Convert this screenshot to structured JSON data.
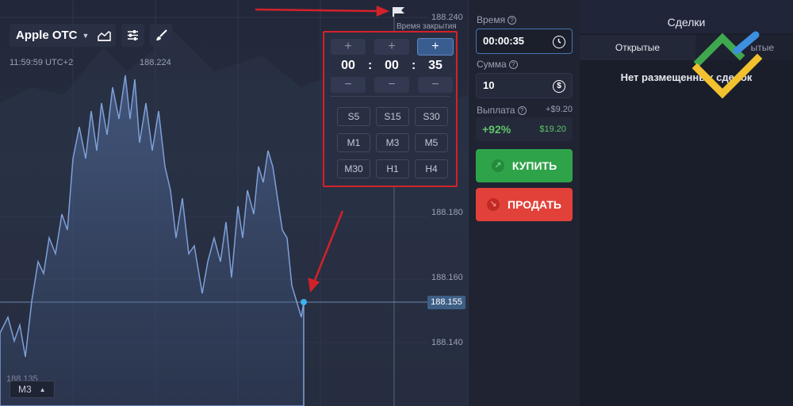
{
  "toolbar": {
    "asset_label": "Apple OTC",
    "timeframe_label": "M3"
  },
  "chart": {
    "time_label": "11:59:59 UTC+2",
    "high_label": "188.224",
    "low_label": "188.135",
    "current_price": "188.155",
    "close_time_label": "Время закрытия",
    "price_axis": [
      "188.240",
      "188.180",
      "188.160",
      "188.140"
    ]
  },
  "picker": {
    "plus": "+",
    "minus": "−",
    "hours": "00",
    "minutes": "00",
    "seconds": "35",
    "colon": ":",
    "presets": [
      "S5",
      "S15",
      "S30",
      "M1",
      "M3",
      "M5",
      "M30",
      "H1",
      "H4"
    ]
  },
  "trade": {
    "time_title": "Время",
    "time_value": "00:00:35",
    "amount_title": "Сумма",
    "amount_value": "10",
    "payout_title": "Выплата",
    "payout_plus": "+$9.20",
    "payout_percent": "+92%",
    "payout_total": "$19.20",
    "buy_label": "КУПИТЬ",
    "sell_label": "ПРОДАТЬ",
    "question_mark": "?"
  },
  "deals": {
    "title": "Сделки",
    "tab_open": "Открытые",
    "tab_closed": "ытые",
    "empty_text": "Нет размещенных сделок"
  },
  "colors": {
    "accent_blue": "#4b74b5",
    "buy_green": "#2fa34a",
    "sell_red": "#e2413a",
    "highlight_red": "#d3212a"
  }
}
